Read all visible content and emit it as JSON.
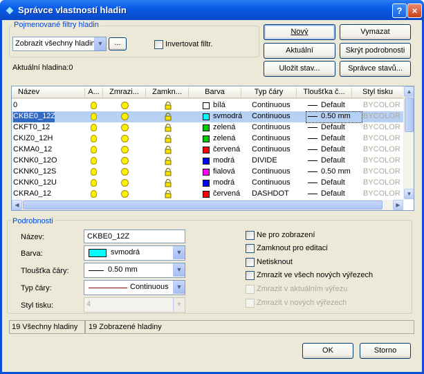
{
  "window": {
    "title": "Správce vlastností hladin",
    "help": "?",
    "close": "×"
  },
  "filters": {
    "group_label": "Pojmenované filtry hladin",
    "selected": "Zobrazit všechny hladin",
    "browse": "...",
    "invert_label": "Invertovat filtr."
  },
  "buttons": {
    "new": "Nový",
    "delete": "Vymazat",
    "current": "Aktuální",
    "hide_details": "Skrýt podrobnosti",
    "save_state": "Uložit stav...",
    "state_manager": "Správce stavů...",
    "ok": "OK",
    "cancel": "Storno"
  },
  "current_layer": "Aktuální hladina:0",
  "columns": [
    "Název",
    "A...",
    "Zmrazi...",
    "Zamkn...",
    "Barva",
    "Typ čáry",
    "Tloušťka č...",
    "Styl tisku"
  ],
  "rows": [
    {
      "name": "0",
      "color_name": "bílá",
      "color": "#ffffff",
      "linetype": "Continuous",
      "lineweight": "Default",
      "plotstyle": "BYCOLOR",
      "selected": false
    },
    {
      "name": "CKBE0_12Z",
      "color_name": "svmodrá",
      "color": "#00ffff",
      "linetype": "Continuous",
      "lineweight": "0.50 mm",
      "plotstyle": "BYCOLOR",
      "selected": true
    },
    {
      "name": "CKFT0_12",
      "color_name": "zelená",
      "color": "#00c800",
      "linetype": "Continuous",
      "lineweight": "Default",
      "plotstyle": "BYCOLOR",
      "selected": false
    },
    {
      "name": "CKIZ0_12H",
      "color_name": "zelená",
      "color": "#00c800",
      "linetype": "Continuous",
      "lineweight": "Default",
      "plotstyle": "BYCOLOR",
      "selected": false
    },
    {
      "name": "CKMA0_12",
      "color_name": "červená",
      "color": "#ff0000",
      "linetype": "Continuous",
      "lineweight": "Default",
      "plotstyle": "BYCOLOR",
      "selected": false
    },
    {
      "name": "CKNK0_12O",
      "color_name": "modrá",
      "color": "#0000ff",
      "linetype": "DIVIDE",
      "lineweight": "Default",
      "plotstyle": "BYCOLOR",
      "selected": false
    },
    {
      "name": "CKNK0_12S",
      "color_name": "fialová",
      "color": "#ff00ff",
      "linetype": "Continuous",
      "lineweight": "0.50 mm",
      "plotstyle": "BYCOLOR",
      "selected": false
    },
    {
      "name": "CKNK0_12U",
      "color_name": "modrá",
      "color": "#0000ff",
      "linetype": "Continuous",
      "lineweight": "Default",
      "plotstyle": "BYCOLOR",
      "selected": false
    },
    {
      "name": "CKRA0_12",
      "color_name": "červená",
      "color": "#ff0000",
      "linetype": "DASHDOT",
      "lineweight": "Default",
      "plotstyle": "BYCOLOR",
      "selected": false
    }
  ],
  "details": {
    "group_label": "Podrobnosti",
    "name_label": "Název:",
    "name_value": "CKBE0_12Z",
    "color_label": "Barva:",
    "color_value": "svmodrá",
    "color_hex": "#00ffff",
    "lineweight_label": "Tloušťka čáry:",
    "lineweight_value": "0.50 mm",
    "linetype_label": "Typ čáry:",
    "linetype_value": "Continuous",
    "plotstyle_label": "Styl tisku:",
    "plotstyle_value": "4",
    "checks": {
      "no_display": "Ne pro zobrazení",
      "lock_edit": "Zamknout pro editaci",
      "no_plot": "Netisknout",
      "freeze_new": "Zmrazit ve všech nových výřezech",
      "freeze_current": "Zmrazit v aktuálním výřezu",
      "freeze_new_vp": "Zmrazit v nových výřezech"
    }
  },
  "status": {
    "all_layers": "19 Všechny hladiny",
    "shown_layers": "19 Zobrazené hladiny"
  }
}
